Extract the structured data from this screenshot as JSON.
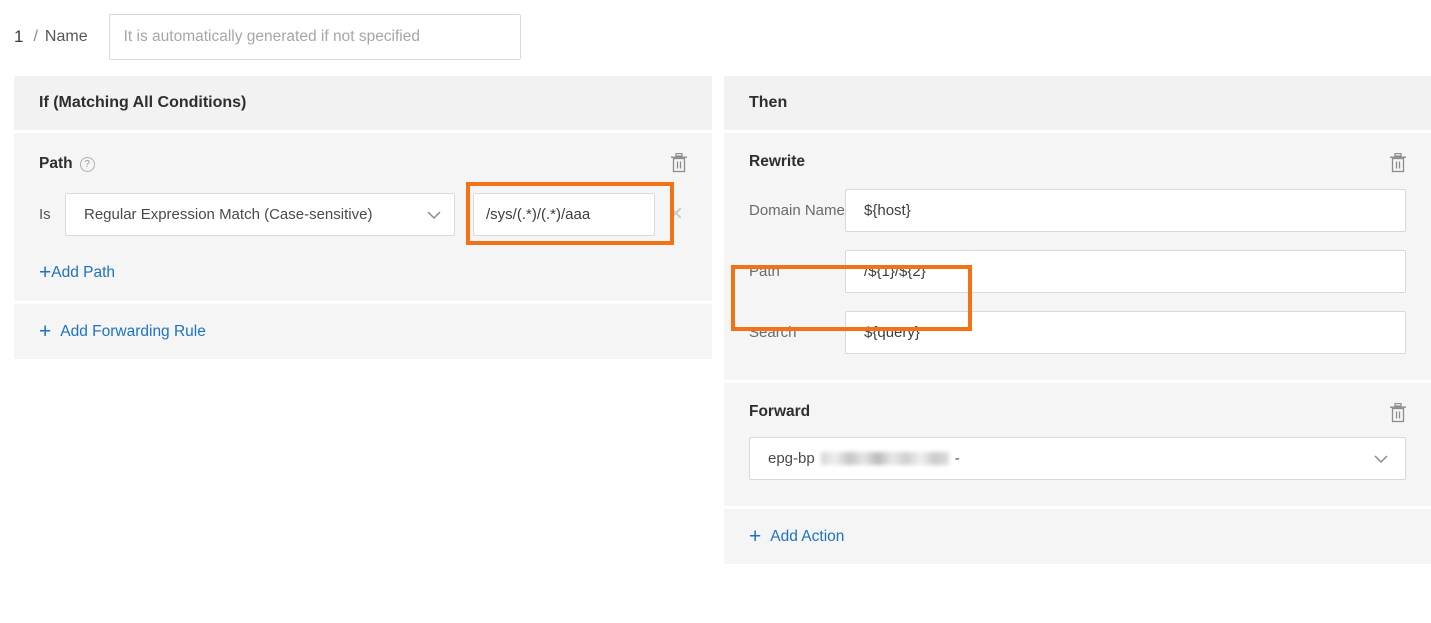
{
  "rule": {
    "index": "1",
    "separator": "/",
    "name_label": "Name",
    "name_value": "",
    "name_placeholder": "It is automatically generated if not specified"
  },
  "if_panel": {
    "header": "If (Matching All Conditions)",
    "condition": {
      "title": "Path",
      "help_icon": "question-circle-icon",
      "operator_label": "Is",
      "match_type": "Regular Expression Match (Case-sensitive)",
      "match_value": "/sys/(.*)/(.*)/aaa",
      "remove_icon": "close-icon",
      "delete_icon": "trash-icon"
    },
    "add_path_label": "Add Path",
    "add_forwarding_rule_label": "Add Forwarding Rule"
  },
  "then_panel": {
    "header": "Then",
    "rewrite": {
      "title": "Rewrite",
      "delete_icon": "trash-icon",
      "fields": [
        {
          "label": "Domain Name",
          "value": "${host}"
        },
        {
          "label": "Path",
          "value": "/${1}/${2}"
        },
        {
          "label": "Search",
          "value": "${query}"
        }
      ]
    },
    "forward": {
      "title": "Forward",
      "delete_icon": "trash-icon",
      "target_prefix": "epg-bp",
      "target_suffix": "-",
      "chevron_icon": "chevron-down-icon"
    },
    "add_action_label": "Add Action"
  },
  "highlights": {
    "color": "#F47216",
    "boxes": [
      {
        "name": "match-value-highlight",
        "target": "if Path match value field"
      },
      {
        "name": "rewrite-path-highlight",
        "target": "then Rewrite Path field"
      }
    ]
  },
  "colors": {
    "link": "#1C72C4",
    "panel_header_bg": "#F2F2F2",
    "panel_body_bg": "#F5F5F5",
    "page_bg": "#FFFFFF",
    "border": "#D9D9D9",
    "text": "#3D3D3D",
    "muted_text": "#6A6A6A"
  }
}
